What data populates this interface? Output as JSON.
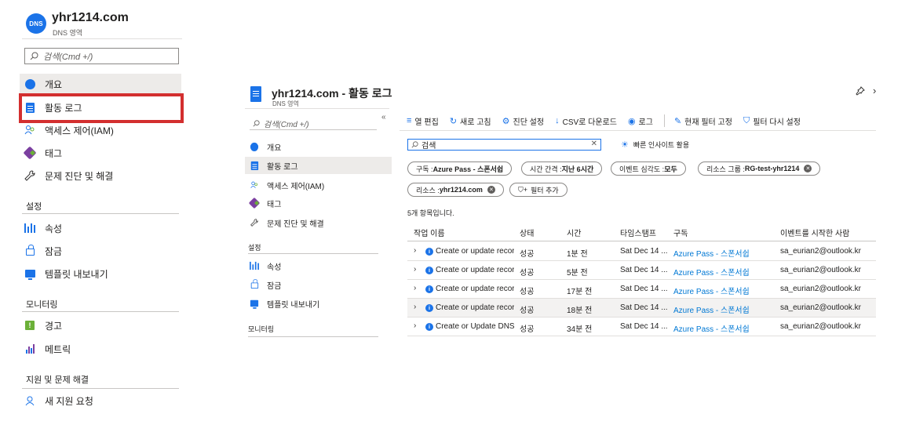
{
  "left_panel": {
    "badge": "DNS",
    "title": "yhr1214.com",
    "subtitle": "DNS 영역",
    "search_placeholder": "검색(Cmd +/)",
    "nav": [
      {
        "label": "개요",
        "icon": "globe-icon"
      },
      {
        "label": "활동 로그",
        "icon": "activity-log-icon"
      },
      {
        "label": "액세스 제어(IAM)",
        "icon": "people-icon"
      },
      {
        "label": "태그",
        "icon": "tag-icon"
      },
      {
        "label": "문제 진단 및 해결",
        "icon": "wrench-icon"
      }
    ],
    "sections": {
      "settings": {
        "title": "설정",
        "items": [
          {
            "label": "속성",
            "icon": "properties-icon"
          },
          {
            "label": "잠금",
            "icon": "lock-icon"
          },
          {
            "label": "템플릿 내보내기",
            "icon": "export-template-icon"
          }
        ]
      },
      "monitoring": {
        "title": "모니터링",
        "items": [
          {
            "label": "경고",
            "icon": "alert-icon"
          },
          {
            "label": "메트릭",
            "icon": "metrics-icon"
          }
        ]
      },
      "support": {
        "title": "지원 및 문제 해결",
        "items": [
          {
            "label": "새 지원 요청",
            "icon": "support-request-icon"
          }
        ]
      }
    }
  },
  "right_panel": {
    "title": "yhr1214.com - 활동 로그",
    "subtitle": "DNS 영역",
    "search_placeholder": "검색(Cmd +/)",
    "nav": [
      {
        "label": "개요"
      },
      {
        "label": "활동 로그"
      },
      {
        "label": "액세스 제어(IAM)"
      },
      {
        "label": "태그"
      },
      {
        "label": "문제 진단 및 해결"
      }
    ],
    "settings_title": "설정",
    "settings_items": [
      {
        "label": "속성"
      },
      {
        "label": "잠금"
      },
      {
        "label": "템플릿 내보내기"
      }
    ],
    "monitoring_title": "모니터링",
    "toolbar": [
      {
        "label": "열 편집",
        "icon": "columns-icon"
      },
      {
        "label": "새로 고침",
        "icon": "refresh-icon"
      },
      {
        "label": "진단 설정",
        "icon": "gear-icon"
      },
      {
        "label": "CSV로 다운로드",
        "icon": "download-icon"
      },
      {
        "label": "로그",
        "icon": "logs-icon"
      },
      {
        "label": "현재 필터 고정",
        "icon": "pin-icon"
      },
      {
        "label": "필터 다시 설정",
        "icon": "filter-reset-icon"
      }
    ],
    "filter_search_value": "검색",
    "insight_label": "빠른 인사이트 활용",
    "pills": [
      {
        "prefix": "구독 : ",
        "value": "Azure Pass - 스폰서쉽",
        "removable": false
      },
      {
        "prefix": "시간 간격 : ",
        "value": "지난 6시간",
        "removable": false
      },
      {
        "prefix": "이벤트 심각도 : ",
        "value": "모두",
        "removable": false
      },
      {
        "prefix": "리소스 그룹 : ",
        "value": "RG-test-yhr1214",
        "removable": true
      },
      {
        "prefix": "리소스 : ",
        "value": "yhr1214.com",
        "removable": true
      }
    ],
    "add_filter_label": "필터 추가",
    "count_text": "5개 항목입니다.",
    "table": {
      "headers": [
        "작업 이름",
        "상태",
        "시간",
        "타임스탬프",
        "구독",
        "이벤트를 시작한 사람"
      ],
      "rows": [
        {
          "op": "Create or update recor",
          "status": "성공",
          "time": "1분 전",
          "timestamp": "Sat Dec 14 ...",
          "subscription": "Azure Pass - 스폰서쉽",
          "initiator": "sa_eurian2@outlook.kr",
          "highlight": false
        },
        {
          "op": "Create or update recor",
          "status": "성공",
          "time": "5분 전",
          "timestamp": "Sat Dec 14 ...",
          "subscription": "Azure Pass - 스폰서쉽",
          "initiator": "sa_eurian2@outlook.kr",
          "highlight": false
        },
        {
          "op": "Create or update recor",
          "status": "성공",
          "time": "17분 전",
          "timestamp": "Sat Dec 14 ...",
          "subscription": "Azure Pass - 스폰서쉽",
          "initiator": "sa_eurian2@outlook.kr",
          "highlight": false
        },
        {
          "op": "Create or update recor",
          "status": "성공",
          "time": "18분 전",
          "timestamp": "Sat Dec 14 ...",
          "subscription": "Azure Pass - 스폰서쉽",
          "initiator": "sa_eurian2@outlook.kr",
          "highlight": true
        },
        {
          "op": "Create or Update DNS",
          "status": "성공",
          "time": "34분 전",
          "timestamp": "Sat Dec 14 ...",
          "subscription": "Azure Pass - 스폰서쉽",
          "initiator": "sa_eurian2@outlook.kr",
          "highlight": false
        }
      ]
    }
  },
  "colors": {
    "accent": "#1b73e8",
    "link": "#0078d4",
    "highlight_border": "#d32f2f",
    "selected_bg": "#edebe9"
  }
}
